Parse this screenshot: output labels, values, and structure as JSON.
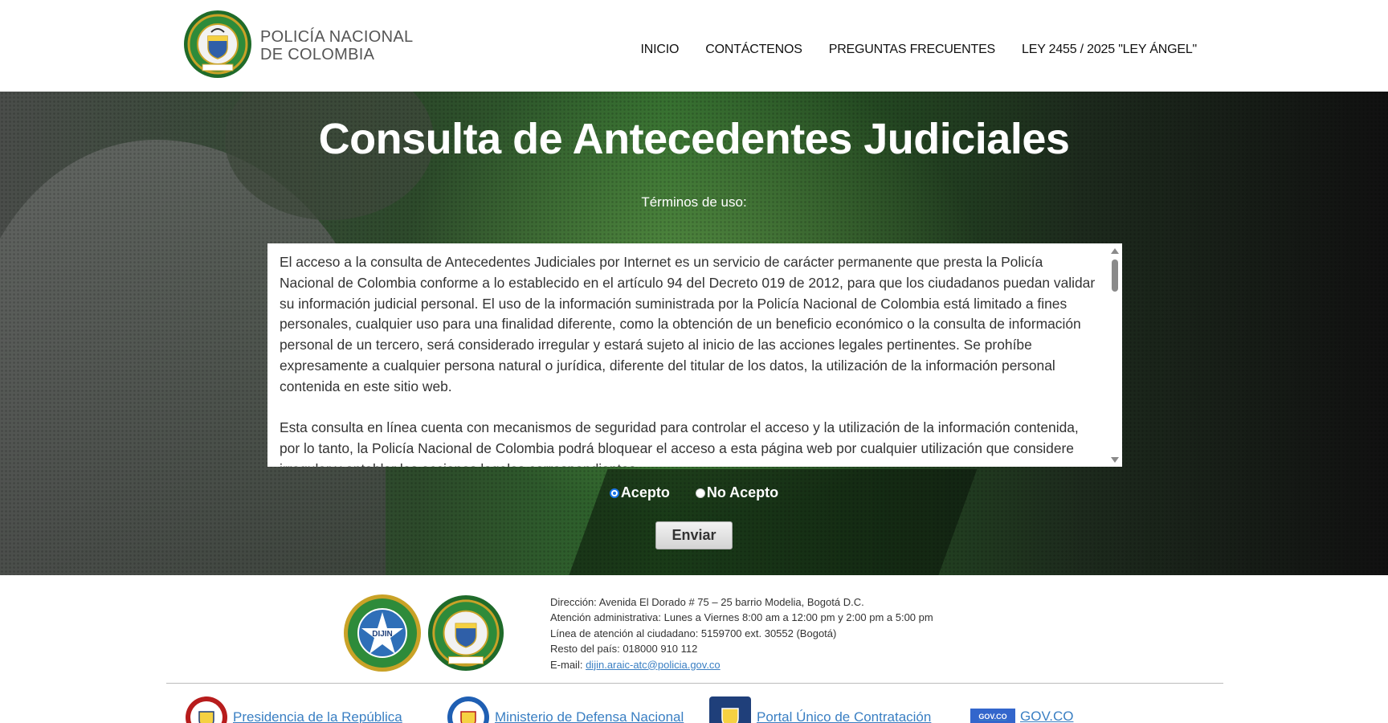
{
  "header": {
    "brand_line1": "POLICÍA NACIONAL",
    "brand_line2": "DE COLOMBIA",
    "nav": [
      "INICIO",
      "CONTÁCTENOS",
      "PREGUNTAS FRECUENTES",
      "LEY 2455 / 2025 \"LEY ÁNGEL\""
    ]
  },
  "hero": {
    "title": "Consulta de Antecedentes Judiciales",
    "terms_label": "Términos de uso:",
    "terms_paragraphs": [
      "El acceso a la consulta de Antecedentes Judiciales por Internet es un servicio de carácter permanente que presta la Policía Nacional de Colombia conforme a lo establecido en el artículo 94 del Decreto 019 de 2012, para que los ciudadanos puedan validar su información judicial personal. El uso de la información suministrada por la Policía Nacional de Colombia está limitado a fines personales, cualquier uso para una finalidad diferente, como la obtención de un beneficio económico o la consulta de información personal de un tercero, será considerado irregular y estará sujeto al inicio de las acciones legales pertinentes. Se prohíbe expresamente a cualquier persona natural o jurídica, diferente del titular de los datos, la utilización de la información personal contenida en este sitio web.",
      "Esta consulta en línea cuenta con mecanismos de seguridad para controlar el acceso y la utilización de la información contenida, por lo tanto, la Policía Nacional de Colombia podrá bloquear el acceso a esta página web por cualquier utilización que considere irregular y entablar las acciones legales correspondientes."
    ],
    "radio_accept": "Acepto",
    "radio_reject": "No Acepto",
    "radio_selected": "Acepto",
    "submit_label": "Enviar"
  },
  "footer": {
    "seal_dijin_text": "DIJIN",
    "address": "Dirección: Avenida El Dorado # 75 – 25 barrio Modelia, Bogotá D.C.",
    "hours": "Atención administrativa: Lunes a Viernes 8:00 am a 12:00 pm y 2:00 pm a 5:00 pm",
    "phone": "Línea de atención al ciudadano: 5159700 ext. 30552 (Bogotá)",
    "rest_country": "Resto del país: 018000 910 112",
    "email_label": "E-mail:",
    "email": "dijin.araic-atc@policia.gov.co",
    "links": [
      "Presidencia de la República",
      "Ministerio de Defensa Nacional",
      "Portal Único de Contratación",
      "GOV.CO"
    ],
    "govco_badge": "GOV.CO"
  },
  "colors": {
    "link": "#3a7fc3",
    "police_green": "#2e7d32",
    "gold": "#c9a227"
  }
}
